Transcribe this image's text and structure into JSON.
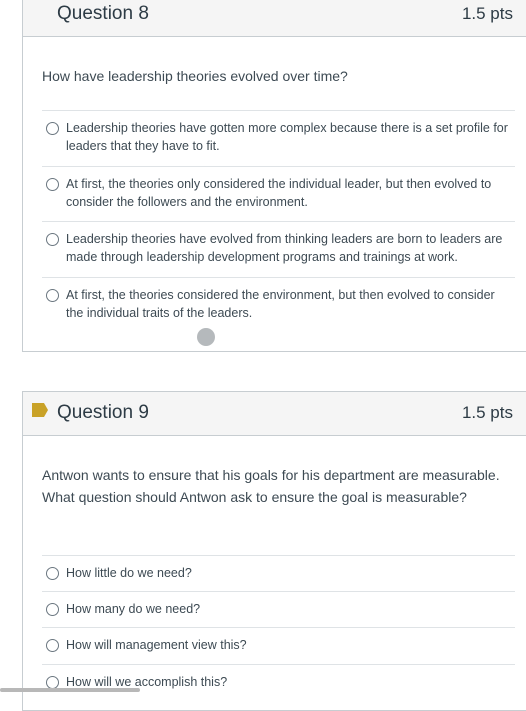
{
  "question8": {
    "title": "Question 8",
    "points": "1.5 pts",
    "prompt": "How have leadership theories evolved over time?",
    "answers": [
      "Leadership theories have gotten more complex because there is a set profile for leaders that they have to fit.",
      "At first, the theories only considered the individual leader, but then evolved to consider the followers and the environment.",
      "Leadership theories have evolved from thinking leaders are born to leaders are made through leadership development programs and trainings at work.",
      "At first, the theories considered the environment, but then evolved to consider the individual traits of the leaders."
    ]
  },
  "question9": {
    "title": "Question 9",
    "points": "1.5 pts",
    "prompt": "Antwon wants to ensure that his goals for his department are measurable. What question should Antwon ask to ensure the goal is measurable?",
    "answers": [
      "How little do we need?",
      "How many do we need?",
      "How will management view this?",
      "How will we accomplish this?"
    ]
  },
  "colors": {
    "header_bg": "#f5f5f5",
    "border": "#c7cdd1",
    "flag": "#c9a227"
  }
}
